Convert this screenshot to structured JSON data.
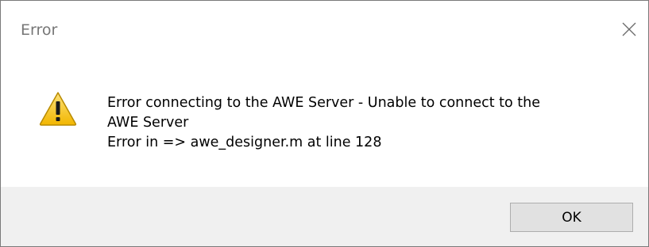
{
  "dialog": {
    "title": "Error",
    "close_icon": "close-icon",
    "icon": "warning-icon",
    "message": {
      "line1": "Error connecting to the AWE Server - Unable to connect to the",
      "line2": "AWE Server",
      "line3": "Error in => awe_designer.m at line 128"
    },
    "ok_label": "OK"
  },
  "colors": {
    "border": "#7a7a7a",
    "footer_bg": "#f0f0f0",
    "button_bg": "#e1e1e1",
    "warning_fill": "#f5c518"
  }
}
